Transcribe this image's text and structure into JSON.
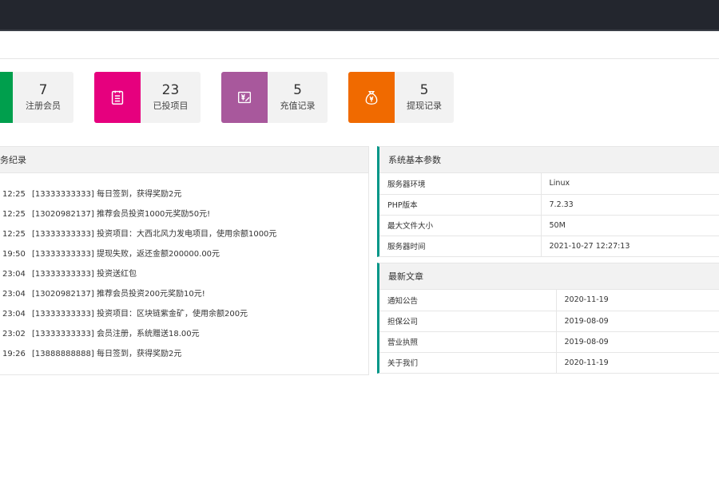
{
  "stats": [
    {
      "value": "7",
      "label": "注册会员",
      "color": "#009f4d",
      "icon": "user-icon"
    },
    {
      "value": "23",
      "label": "已投项目",
      "color": "#e6007e",
      "icon": "clipboard-icon"
    },
    {
      "value": "5",
      "label": "充值记录",
      "color": "#a8589c",
      "icon": "yen-card-icon"
    },
    {
      "value": "5",
      "label": "提现记录",
      "color": "#f06a00",
      "icon": "money-bag-icon"
    }
  ],
  "log_panel": {
    "title": "务纪录",
    "rows": [
      {
        "time": "12:25",
        "msg": "[13333333333] 每日签到，获得奖励2元"
      },
      {
        "time": "12:25",
        "msg": "[13020982137] 推荐会员投资1000元奖励50元!"
      },
      {
        "time": "12:25",
        "msg": "[13333333333] 投资项目：大西北风力发电项目，使用余额1000元"
      },
      {
        "time": "19:50",
        "msg": "[13333333333] 提现失败，返还金额200000.00元"
      },
      {
        "time": "23:04",
        "msg": "[13333333333] 投资送红包"
      },
      {
        "time": "23:04",
        "msg": "[13020982137] 推荐会员投资200元奖励10元!"
      },
      {
        "time": "23:04",
        "msg": "[13333333333] 投资项目：区块链紫金矿，使用余额200元"
      },
      {
        "time": "23:02",
        "msg": "[13333333333] 会员注册，系统赠送18.00元"
      },
      {
        "time": "19:26",
        "msg": "[13888888888] 每日签到，获得奖励2元"
      }
    ]
  },
  "sys_panel": {
    "title": "系统基本参数",
    "rows": [
      {
        "k": "服务器环境",
        "v": "Linux"
      },
      {
        "k": "PHP版本",
        "v": "7.2.33"
      },
      {
        "k": "最大文件大小",
        "v": "50M"
      },
      {
        "k": "服务器时间",
        "v": "2021-10-27 12:27:13"
      }
    ]
  },
  "article_panel": {
    "title": "最新文章",
    "rows": [
      {
        "k": "通知公告",
        "v": "2020-11-19"
      },
      {
        "k": "担保公司",
        "v": "2019-08-09"
      },
      {
        "k": "营业执照",
        "v": "2019-08-09"
      },
      {
        "k": "关于我们",
        "v": "2020-11-19"
      }
    ]
  }
}
